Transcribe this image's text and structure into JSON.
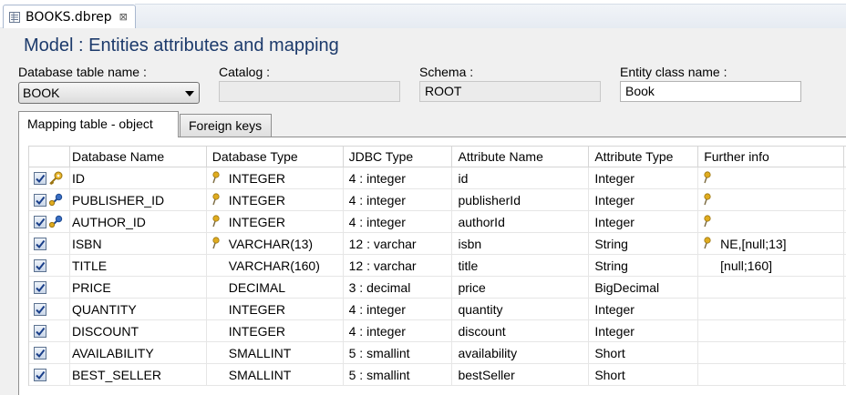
{
  "editor_tab": {
    "title": "BOOKS.dbrep",
    "close": "⊠"
  },
  "page_title": "Model : Entities attributes and mapping",
  "fields": {
    "table_name_label": "Database table name :",
    "table_name_value": "BOOK",
    "catalog_label": "Catalog :",
    "catalog_value": "",
    "schema_label": "Schema :",
    "schema_value": "ROOT",
    "entity_label": "Entity class name :",
    "entity_value": "Book"
  },
  "tabs": [
    {
      "label": "Mapping table - object",
      "active": true
    },
    {
      "label": "Foreign keys",
      "active": false
    }
  ],
  "columns": [
    "Database Name",
    "Database Type",
    "JDBC Type",
    "Attribute Name",
    "Attribute Type",
    "Further info"
  ],
  "rows": [
    {
      "db_name": "ID",
      "db_type": "INTEGER",
      "jdbc": "4 : integer",
      "attr": "id",
      "attr_type": "Integer",
      "further": "",
      "key": "primary",
      "type_pin": true,
      "further_pin": true
    },
    {
      "db_name": "PUBLISHER_ID",
      "db_type": "INTEGER",
      "jdbc": "4 : integer",
      "attr": "publisherId",
      "attr_type": "Integer",
      "further": "",
      "key": "foreign",
      "type_pin": true,
      "further_pin": true
    },
    {
      "db_name": "AUTHOR_ID",
      "db_type": "INTEGER",
      "jdbc": "4 : integer",
      "attr": "authorId",
      "attr_type": "Integer",
      "further": "",
      "key": "foreign",
      "type_pin": true,
      "further_pin": true
    },
    {
      "db_name": "ISBN",
      "db_type": "VARCHAR(13)",
      "jdbc": "12 : varchar",
      "attr": "isbn",
      "attr_type": "String",
      "further": "NE,[null;13]",
      "key": "",
      "type_pin": true,
      "further_pin": true
    },
    {
      "db_name": "TITLE",
      "db_type": "VARCHAR(160)",
      "jdbc": "12 : varchar",
      "attr": "title",
      "attr_type": "String",
      "further": "[null;160]",
      "key": "",
      "type_pin": false,
      "further_pin": false
    },
    {
      "db_name": "PRICE",
      "db_type": "DECIMAL",
      "jdbc": "3 : decimal",
      "attr": "price",
      "attr_type": "BigDecimal",
      "further": "",
      "key": "",
      "type_pin": false,
      "further_pin": false
    },
    {
      "db_name": "QUANTITY",
      "db_type": "INTEGER",
      "jdbc": "4 : integer",
      "attr": "quantity",
      "attr_type": "Integer",
      "further": "",
      "key": "",
      "type_pin": false,
      "further_pin": false
    },
    {
      "db_name": "DISCOUNT",
      "db_type": "INTEGER",
      "jdbc": "4 : integer",
      "attr": "discount",
      "attr_type": "Integer",
      "further": "",
      "key": "",
      "type_pin": false,
      "further_pin": false
    },
    {
      "db_name": "AVAILABILITY",
      "db_type": "SMALLINT",
      "jdbc": "5 : smallint",
      "attr": "availability",
      "attr_type": "Short",
      "further": "",
      "key": "",
      "type_pin": false,
      "further_pin": false
    },
    {
      "db_name": "BEST_SELLER",
      "db_type": "SMALLINT",
      "jdbc": "5 : smallint",
      "attr": "bestSeller",
      "attr_type": "Short",
      "further": "",
      "key": "",
      "type_pin": false,
      "further_pin": false
    }
  ],
  "colors": {
    "title": "#1c3a6b",
    "key_gold": "#d9a520",
    "fk_blue": "#2f5fb3",
    "check": "#1a3f8a"
  }
}
